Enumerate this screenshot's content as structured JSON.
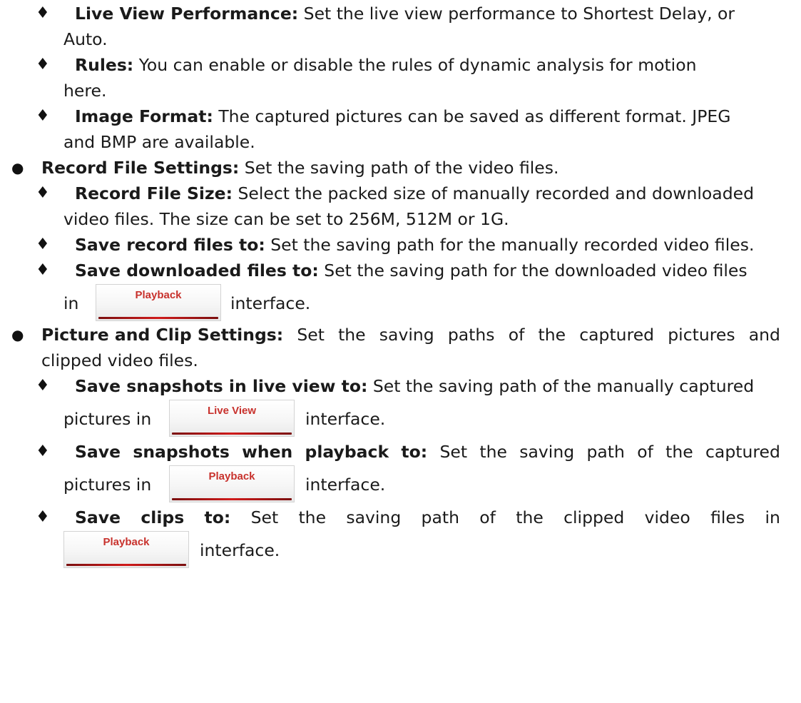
{
  "colors": {
    "button_text": "#c8322d",
    "button_underline": "#c01818",
    "text": "#1a1a1a"
  },
  "icons": {
    "level2_marker": "black-diamond-icon",
    "level1_marker": "black-circle-icon"
  },
  "marker_diamond": "♦",
  "marker_bullet": "●",
  "items": {
    "live_view_performance": {
      "label": "Live View Performance:",
      "text_1": " Set the live view performance to Shortest Delay, or",
      "text_2": "Auto."
    },
    "rules": {
      "label": "Rules:",
      "text_1": " You can enable or disable the rules of dynamic analysis for motion",
      "text_2": "here."
    },
    "image_format": {
      "label": "Image Format:",
      "text_1": " The captured pictures can be saved as different format. JPEG",
      "text_2": "and BMP are available."
    },
    "record_file_settings": {
      "label": "Record File Settings:",
      "text_1": " Set the saving path of the video files."
    },
    "record_file_size": {
      "label": "Record File Size:",
      "text_1": " Select the packed size of manually recorded and downloaded",
      "text_2": "video files. The size can be set to 256M, 512M or 1G."
    },
    "save_record_files": {
      "label": "Save record files to:",
      "text_1": " Set the saving path for the manually recorded video files."
    },
    "save_downloaded_files": {
      "label": "Save downloaded files to:",
      "text_1": " Set the saving path for the downloaded video files",
      "text_2a": "in",
      "button": "Playback",
      "text_2b": "interface."
    },
    "picture_clip_settings": {
      "label": "Picture and Clip Settings:",
      "words_1": [
        "Set",
        "the",
        "saving",
        "paths",
        "of",
        "the",
        "captured",
        "pictures",
        "and"
      ],
      "text_2": "clipped video files."
    },
    "save_snapshots_live": {
      "label": "Save snapshots in live view to:",
      "text_1": " Set the saving path of the manually captured",
      "text_2a": "pictures in",
      "button": "Live View",
      "text_2b": "interface."
    },
    "save_snapshots_playback": {
      "label_words": [
        "Save",
        "snapshots",
        "when",
        "playback",
        "to:"
      ],
      "words_1": [
        "Set",
        "the",
        "saving",
        "path",
        "of",
        "the",
        "captured"
      ],
      "text_2a": "pictures in",
      "button": "Playback",
      "text_2b": "interface."
    },
    "save_clips": {
      "label_words": [
        "Save",
        "clips",
        "to:"
      ],
      "words_1": [
        "Set",
        "the",
        "saving",
        "path",
        "of",
        "the",
        "clipped",
        "video",
        "files",
        "in"
      ],
      "button": "Playback",
      "text_2b": "interface."
    }
  }
}
